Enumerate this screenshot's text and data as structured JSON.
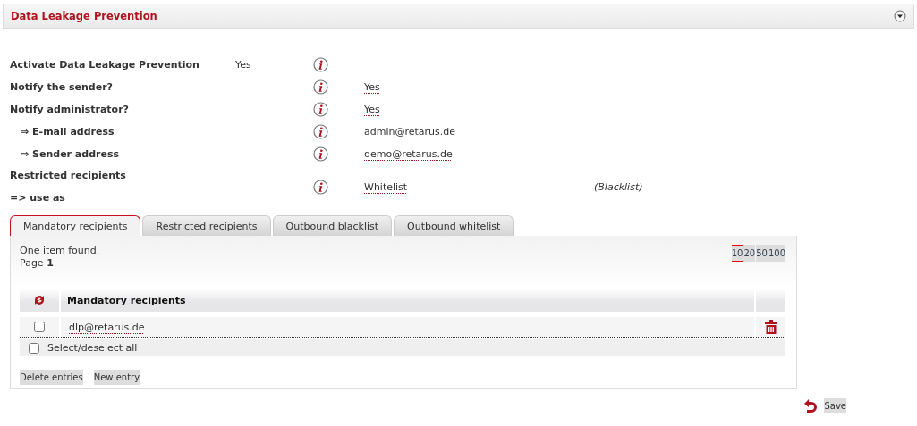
{
  "panel": {
    "title": "Data Leakage Prevention",
    "expanded": true
  },
  "settings": [
    {
      "kind": "inline",
      "label": "Activate Data Leakage Prevention",
      "value": "Yes"
    },
    {
      "kind": "right",
      "label": "Notify the sender?",
      "value": "Yes"
    },
    {
      "kind": "right",
      "label": "Notify administrator?",
      "value": "Yes",
      "children": [
        {
          "kind": "right",
          "label": "⇒ E-mail address",
          "value": "admin@retarus.de"
        },
        {
          "kind": "right",
          "label": "⇒ Sender address",
          "value": "demo@retarus.de"
        }
      ]
    },
    {
      "kind": "split",
      "label_lines": [
        "Restricted recipients",
        "=> use as"
      ],
      "value": "Whitelist",
      "note": "(Blacklist)"
    }
  ],
  "tabs": [
    {
      "label": "Mandatory recipients",
      "selected": true
    },
    {
      "label": "Restricted recipients",
      "selected": false
    },
    {
      "label": "Outbound blacklist",
      "selected": false
    },
    {
      "label": "Outbound whitelist",
      "selected": false
    }
  ],
  "results": {
    "count_text": "One item found.",
    "page_label": "Page",
    "page_number": "1"
  },
  "page_sizes": [
    {
      "label": "10",
      "selected": true
    },
    {
      "label": "20",
      "selected": false
    },
    {
      "label": "50",
      "selected": false
    },
    {
      "label": "100",
      "selected": false
    }
  ],
  "table": {
    "columns": [
      "Mandatory recipients"
    ],
    "rows": [
      {
        "checked": false,
        "value": "dlp@retarus.de"
      }
    ],
    "select_all": {
      "label": "Select/deselect all",
      "checked": false
    }
  },
  "buttons": [
    "Delete entries",
    "New entry"
  ],
  "save": "Save"
}
